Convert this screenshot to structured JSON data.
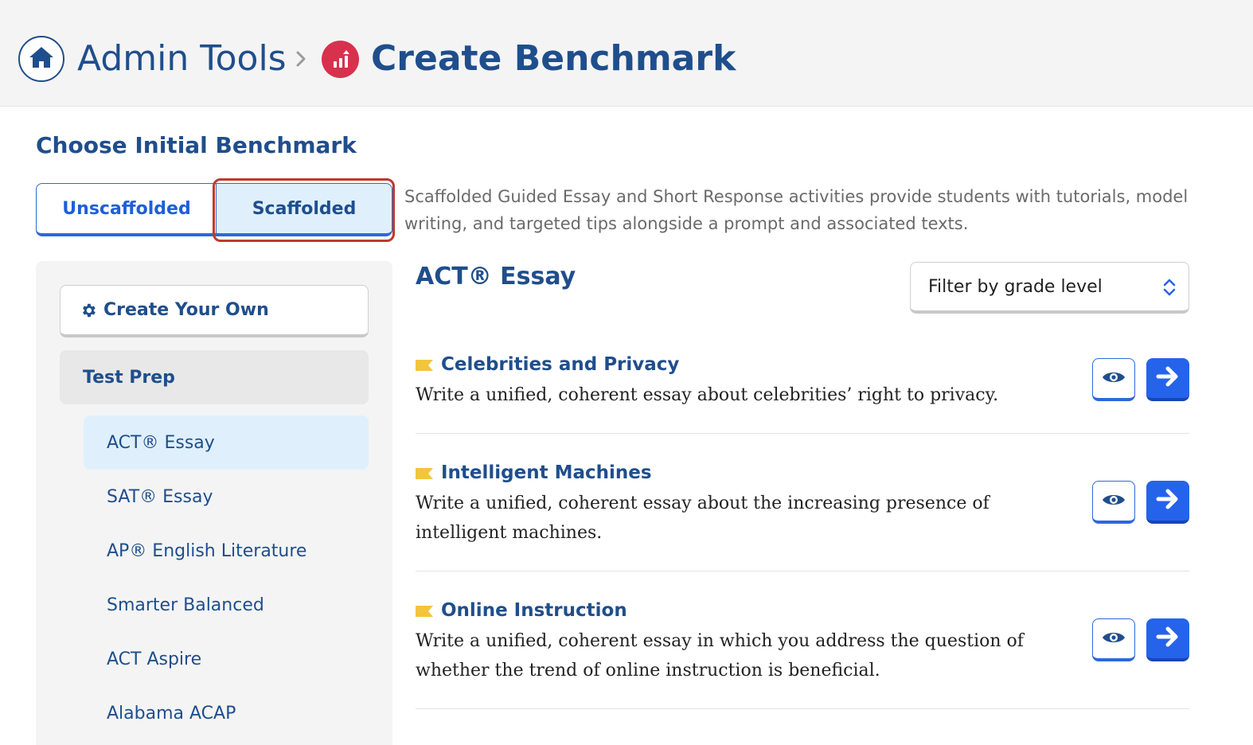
{
  "header": {
    "home_icon": "home-icon",
    "breadcrumb_admin": "Admin Tools",
    "separator_icon": "chevron-right-icon",
    "benchmark_icon": "chart-up-icon",
    "title": "Create Benchmark"
  },
  "section_title": "Choose Initial Benchmark",
  "toggle": {
    "unscaffolded_label": "Unscaffolded",
    "scaffolded_label": "Scaffolded",
    "selected": "Scaffolded",
    "description": "Scaffolded Guided Essay and Short Response activities provide students with tutorials, model writing, and targeted tips alongside a prompt and associated texts."
  },
  "sidebar": {
    "create_own_label": "Create Your Own",
    "create_own_icon": "gear-icon",
    "group_label": "Test Prep",
    "items": [
      {
        "label": "ACT® Essay",
        "active": true
      },
      {
        "label": "SAT® Essay",
        "active": false
      },
      {
        "label": "AP® English Literature",
        "active": false
      },
      {
        "label": "Smarter Balanced",
        "active": false
      },
      {
        "label": "ACT Aspire",
        "active": false
      },
      {
        "label": "Alabama ACAP",
        "active": false
      }
    ]
  },
  "content": {
    "title": "ACT® Essay",
    "filter_label": "Filter by grade level",
    "items": [
      {
        "title": "Celebrities and Privacy",
        "description": "Write a unified, coherent essay about celebrities’ right to privacy."
      },
      {
        "title": "Intelligent Machines",
        "description": "Write a unified, coherent essay about the increasing presence of intelligent machines."
      },
      {
        "title": "Online Instruction",
        "description": "Write a unified, coherent essay in which you address the question of whether the trend of online instruction is beneficial."
      }
    ]
  },
  "colors": {
    "primary_navy": "#1f4e8c",
    "accent_blue": "#2563eb",
    "benchmark_red": "#d8314e",
    "flag_yellow": "#f2c53d",
    "selected_bg": "#dff0fc",
    "highlight_red": "#c0392b"
  }
}
